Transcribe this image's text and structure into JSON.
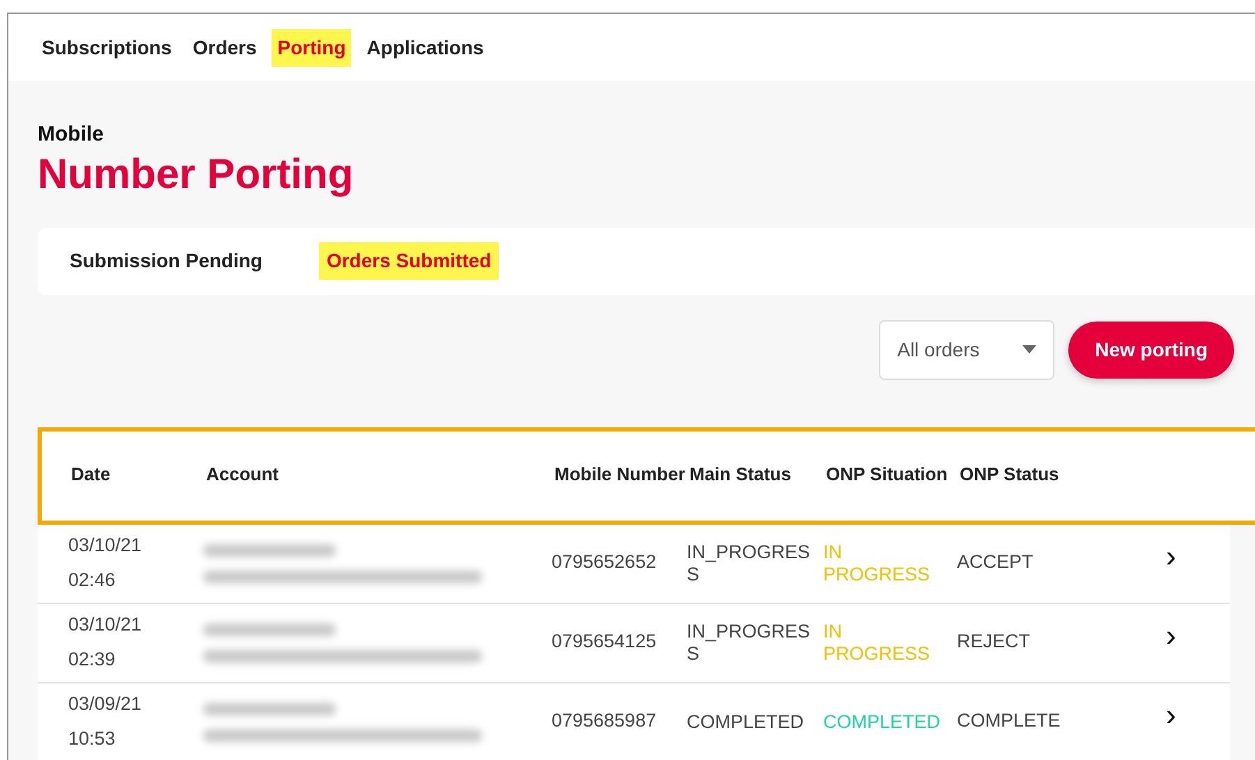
{
  "nav": [
    {
      "label": "Subscriptions",
      "selected": false
    },
    {
      "label": "Orders",
      "selected": false
    },
    {
      "label": "Porting",
      "selected": true
    },
    {
      "label": "Applications",
      "selected": false
    }
  ],
  "eyebrow": "Mobile",
  "title": "Number Porting",
  "subtabs": [
    {
      "label": "Submission Pending",
      "selected": false
    },
    {
      "label": "Orders Submitted",
      "selected": true
    }
  ],
  "filter": {
    "value": "All orders"
  },
  "new_button": "New porting",
  "table": {
    "columns": [
      "Date",
      "Account",
      "Mobile Number",
      "Main Status",
      "ONP Situation",
      "ONP Status"
    ],
    "rows": [
      {
        "date": "03/10/21",
        "time": "02:46",
        "mobile": "0795652652",
        "main_status": "IN_PROGRESS",
        "onp_situation": "IN PROGRESS",
        "color": "#f5c000",
        "onp_status": "ACCEPT",
        "chevron": "›"
      },
      {
        "date": "03/10/21",
        "time": "02:39",
        "mobile": "0795654125",
        "main_status": "IN_PROGRESS",
        "onp_situation": "IN PROGRESS",
        "color": "#f5c000",
        "onp_status": "REJECT",
        "chevron": "›"
      },
      {
        "date": "03/09/21",
        "time": "10:53",
        "mobile": "0795685987",
        "main_status": "COMPLETED",
        "onp_situation": "COMPLETED",
        "color": "#1ed6a0",
        "onp_status": "COMPLETE",
        "chevron": "›"
      }
    ]
  }
}
